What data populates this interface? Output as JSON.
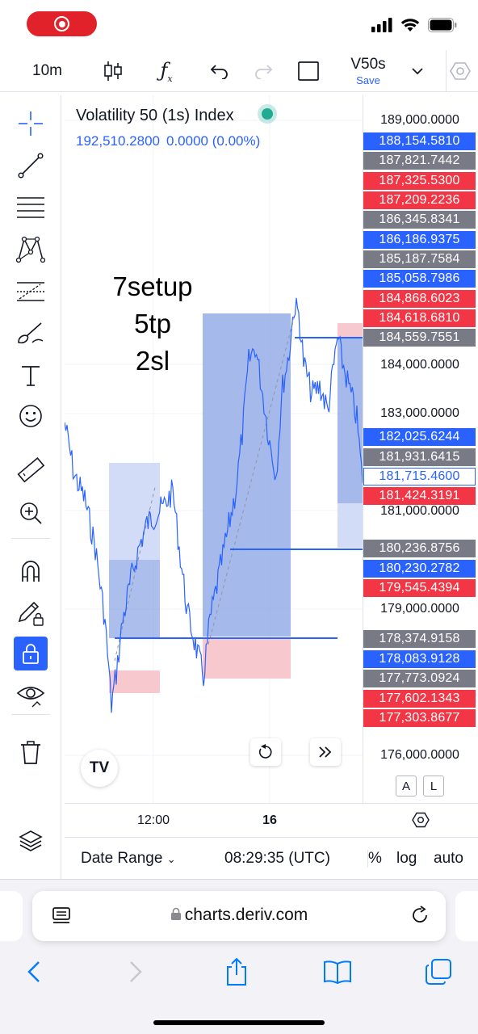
{
  "toolbar": {
    "interval": "10m",
    "layout_name": "V50s",
    "save_label": "Save"
  },
  "legend": {
    "symbol": "Volatility 50 (1s) Index",
    "price": "192,510.2800",
    "change": "0.0000",
    "change_pct": "(0.00%)"
  },
  "annotation": [
    "7setup",
    "5tp",
    "2sl"
  ],
  "price_axis": {
    "ticks": [
      "189,000.0000",
      "184,000.0000",
      "183,000.0000",
      "181,000.0000",
      "179,000.0000",
      "176,000.0000"
    ],
    "labels": [
      {
        "value": "188,154.5810",
        "color": "#2962ff"
      },
      {
        "value": "187,821.7442",
        "color": "#787b86"
      },
      {
        "value": "187,325.5300",
        "color": "#f23645"
      },
      {
        "value": "187,209.2236",
        "color": "#f23645"
      },
      {
        "value": "186,345.8341",
        "color": "#787b86"
      },
      {
        "value": "186,186.9375",
        "color": "#2962ff"
      },
      {
        "value": "185,187.7584",
        "color": "#787b86"
      },
      {
        "value": "185,058.7986",
        "color": "#2962ff"
      },
      {
        "value": "184,868.6023",
        "color": "#f23645"
      },
      {
        "value": "184,618.6810",
        "color": "#f23645"
      },
      {
        "value": "184,559.7551",
        "color": "#787b86"
      },
      {
        "value": "182,025.6244",
        "color": "#2962ff"
      },
      {
        "value": "181,931.6415",
        "color": "#787b86"
      },
      {
        "value": "181,715.4600",
        "color": "current"
      },
      {
        "value": "181,424.3191",
        "color": "#f23645"
      },
      {
        "value": "180,236.8756",
        "color": "#787b86"
      },
      {
        "value": "180,230.2782",
        "color": "#2962ff"
      },
      {
        "value": "179,545.4394",
        "color": "#f23645"
      },
      {
        "value": "178,374.9158",
        "color": "#787b86"
      },
      {
        "value": "178,083.9128",
        "color": "#2962ff"
      },
      {
        "value": "177,773.0924",
        "color": "#787b86"
      },
      {
        "value": "177,602.1343",
        "color": "#f23645"
      },
      {
        "value": "177,303.8677",
        "color": "#f23645"
      }
    ]
  },
  "time_axis": {
    "labels": [
      "12:00",
      "16"
    ]
  },
  "bottom_bar": {
    "date_range": "Date Range",
    "clock": "08:29:35 (UTC)",
    "percent": "%",
    "log": "log",
    "auto": "auto"
  },
  "scale_buttons": {
    "a": "A",
    "l": "L"
  },
  "browser": {
    "url": "charts.deriv.com"
  },
  "colors": {
    "accent": "#2962ff",
    "long_zone": "#6f8fdf",
    "stop_zone": "#f7c1c8",
    "up_color": "#2962ff",
    "market_open": "#22ab94"
  }
}
